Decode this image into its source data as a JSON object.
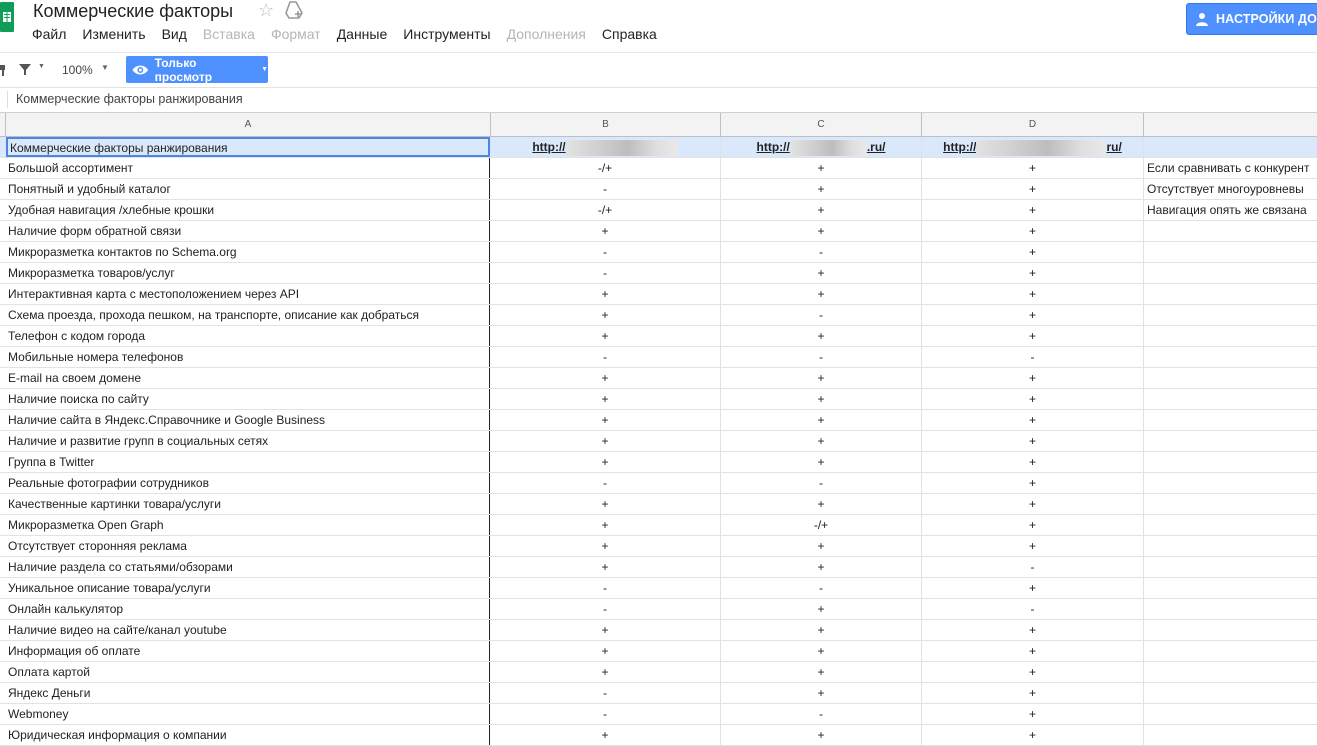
{
  "app": {
    "title": "Коммерческие факторы",
    "star_icon": "star-icon",
    "drive_icon": "drive-icon"
  },
  "menu": [
    {
      "label": "Файл",
      "disabled": false
    },
    {
      "label": "Изменить",
      "disabled": false
    },
    {
      "label": "Вид",
      "disabled": false
    },
    {
      "label": "Вставка",
      "disabled": true
    },
    {
      "label": "Формат",
      "disabled": true
    },
    {
      "label": "Данные",
      "disabled": false
    },
    {
      "label": "Инструменты",
      "disabled": false
    },
    {
      "label": "Дополнения",
      "disabled": true
    },
    {
      "label": "Справка",
      "disabled": false
    }
  ],
  "settings_button": {
    "label": "НАСТРОЙКИ ДО",
    "icon": "person-icon",
    "color": "#4d90fe"
  },
  "toolbar": {
    "zoom": "100%",
    "view_only_label": "Только просмотр",
    "view_only_icon": "eye-icon"
  },
  "formula_bar": {
    "value": "Коммерческие факторы ранжирования"
  },
  "columns": [
    "A",
    "B",
    "C",
    "D"
  ],
  "header_row": {
    "a": "Коммерческие факторы ранжирования",
    "b_prefix": "http://",
    "b_suffix": "",
    "c_prefix": "http://",
    "c_suffix": ".ru/",
    "d_prefix": "http://",
    "d_suffix": "ru/"
  },
  "rows": [
    {
      "a": "Большой ассортимент",
      "b": "-/+",
      "c": "+",
      "d": "+",
      "e": "Если сравнивать с конкурент"
    },
    {
      "a": "Понятный и удобный каталог",
      "b": "-",
      "c": "+",
      "d": "+",
      "e": "Отсутствует многоуровневы"
    },
    {
      "a": "Удобная навигация /хлебные крошки",
      "b": "-/+",
      "c": "+",
      "d": "+",
      "e": "Навигация опять же связана"
    },
    {
      "a": "Наличие форм обратной связи",
      "b": "+",
      "c": "+",
      "d": "+",
      "e": ""
    },
    {
      "a": "Микроразметка контактов по Schema.org",
      "b": "-",
      "c": "-",
      "d": "+",
      "e": ""
    },
    {
      "a": "Микроразметка товаров/услуг",
      "b": "-",
      "c": "+",
      "d": "+",
      "e": ""
    },
    {
      "a": "Интерактивная карта с местоположением через API",
      "b": "+",
      "c": "+",
      "d": "+",
      "e": ""
    },
    {
      "a": "Схема проезда, прохода пешком, на транспорте, описание как добраться",
      "b": "+",
      "c": "-",
      "d": "+",
      "e": ""
    },
    {
      "a": "Телефон с кодом города",
      "b": "+",
      "c": "+",
      "d": "+",
      "e": ""
    },
    {
      "a": "Мобильные номера телефонов",
      "b": "-",
      "c": "-",
      "d": "-",
      "e": ""
    },
    {
      "a": "E-mail на своем домене",
      "b": "+",
      "c": "+",
      "d": "+",
      "e": ""
    },
    {
      "a": "Наличие поиска по сайту",
      "b": "+",
      "c": "+",
      "d": "+",
      "e": ""
    },
    {
      "a": "Наличие сайта в Яндекс.Справочнике и Google Business",
      "b": "+",
      "c": "+",
      "d": "+",
      "e": ""
    },
    {
      "a": "Наличие и развитие групп в социальных сетях",
      "b": "+",
      "c": "+",
      "d": "+",
      "e": ""
    },
    {
      "a": "Группа в Twitter",
      "b": "+",
      "c": "+",
      "d": "+",
      "e": ""
    },
    {
      "a": "Реальные фотографии сотрудников",
      "b": "-",
      "c": "-",
      "d": "+",
      "e": ""
    },
    {
      "a": "Качественные картинки товара/услуги",
      "b": "+",
      "c": "+",
      "d": "+",
      "e": ""
    },
    {
      "a": "Микроразметка Open Graph",
      "b": "+",
      "c": "-/+",
      "d": "+",
      "e": ""
    },
    {
      "a": "Отсутствует сторонняя реклама",
      "b": "+",
      "c": "+",
      "d": "+",
      "e": ""
    },
    {
      "a": "Наличие раздела со статьями/обзорами",
      "b": "+",
      "c": "+",
      "d": "-",
      "e": ""
    },
    {
      "a": "Уникальное описание товара/услуги",
      "b": "-",
      "c": "-",
      "d": "+",
      "e": ""
    },
    {
      "a": "Онлайн калькулятор",
      "b": "-",
      "c": "+",
      "d": "-",
      "e": ""
    },
    {
      "a": "Наличие видео на сайте/канал youtube",
      "b": "+",
      "c": "+",
      "d": "+",
      "e": ""
    },
    {
      "a": "Информация об оплате",
      "b": "+",
      "c": "+",
      "d": "+",
      "e": ""
    },
    {
      "a": "Оплата картой",
      "b": "+",
      "c": "+",
      "d": "+",
      "e": ""
    },
    {
      "a": "Яндекс Деньги",
      "b": "-",
      "c": "+",
      "d": "+",
      "e": ""
    },
    {
      "a": "Webmoney",
      "b": "-",
      "c": "-",
      "d": "+",
      "e": ""
    },
    {
      "a": "Юридическая информация о компании",
      "b": "+",
      "c": "+",
      "d": "+",
      "e": ""
    }
  ]
}
